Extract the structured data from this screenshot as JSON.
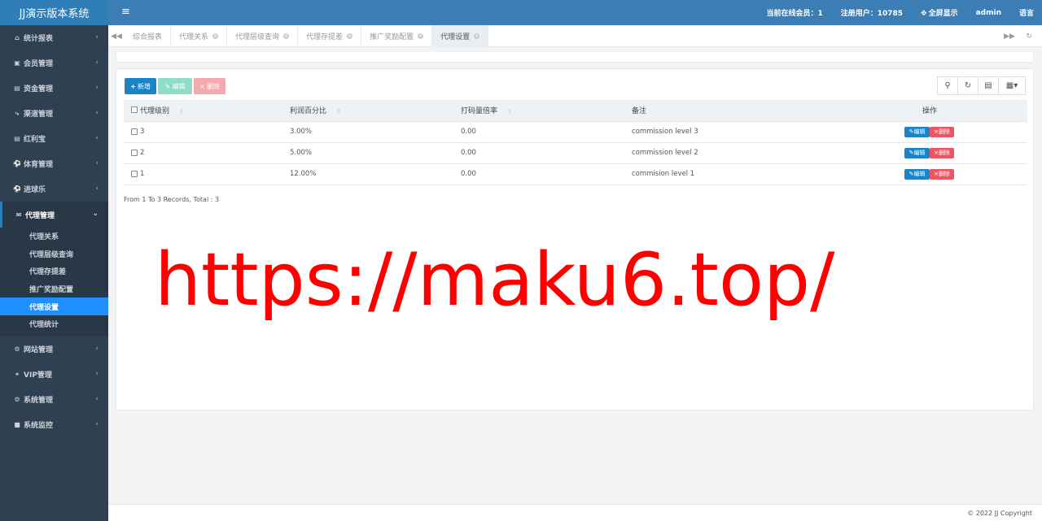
{
  "app": {
    "title": "JJ演示版本系统"
  },
  "header": {
    "online_label": "当前在线会员：1",
    "registered_label": "注册用户：10785",
    "fullscreen_label": "全屏显示",
    "user_label": "admin",
    "language_label": "语言"
  },
  "sidebar": {
    "items": [
      {
        "label": "统计报表",
        "icon": "home-icon"
      },
      {
        "label": "会员管理",
        "icon": "user-card-icon"
      },
      {
        "label": "资金管理",
        "icon": "database-icon"
      },
      {
        "label": "渠道管理",
        "icon": "share-icon"
      },
      {
        "label": "红利宝",
        "icon": "database-icon"
      },
      {
        "label": "体育管理",
        "icon": "soccer-icon"
      },
      {
        "label": "进球乐",
        "icon": "soccer-icon"
      }
    ],
    "open": {
      "label": "代理管理",
      "icon": "envelope-icon",
      "children": [
        {
          "label": "代理关系"
        },
        {
          "label": "代理层级查询"
        },
        {
          "label": "代理存提差"
        },
        {
          "label": "推广奖励配置"
        },
        {
          "label": "代理设置",
          "active": true
        },
        {
          "label": "代理统计"
        }
      ]
    },
    "items_after": [
      {
        "label": "网站管理",
        "icon": "gears-icon"
      },
      {
        "label": "VIP管理",
        "icon": "lock-icon"
      },
      {
        "label": "系统管理",
        "icon": "gear-icon"
      },
      {
        "label": "系统监控",
        "icon": "video-camera-icon"
      }
    ]
  },
  "tabs": [
    {
      "label": "综合报表",
      "closable": false
    },
    {
      "label": "代理关系",
      "closable": true
    },
    {
      "label": "代理层级查询",
      "closable": true
    },
    {
      "label": "代理存提差",
      "closable": true
    },
    {
      "label": "推广奖励配置",
      "closable": true
    },
    {
      "label": "代理设置",
      "closable": true,
      "active": true
    }
  ],
  "toolbar": {
    "add_label": "新增",
    "edit_label": "编辑",
    "delete_label": "删除"
  },
  "table": {
    "columns": [
      "代理级别",
      "利润百分比",
      "打码量倍率",
      "备注",
      "操作"
    ],
    "rows": [
      {
        "level": "3",
        "percent": "3.00%",
        "rate": "0.00",
        "note": "commission level 3"
      },
      {
        "level": "2",
        "percent": "5.00%",
        "rate": "0.00",
        "note": "commission level 2"
      },
      {
        "level": "1",
        "percent": "12.00%",
        "rate": "0.00",
        "note": "commision level 1"
      }
    ],
    "row_edit_label": "编辑",
    "row_delete_label": "删除"
  },
  "pager": {
    "text": "From 1 To 3 Records, Total : 3"
  },
  "watermark": {
    "text": "https://maku6.top/"
  },
  "footer": {
    "copyright": "© 2022 JJ Copyright"
  },
  "colors": {
    "brand": "#2f7eb8",
    "header": "#3b7db4",
    "sidebar": "#2f4050",
    "active_sub": "#1e90ff",
    "primary": "#1c84c6",
    "danger": "#ed5565",
    "watermark": "#ff0000"
  }
}
